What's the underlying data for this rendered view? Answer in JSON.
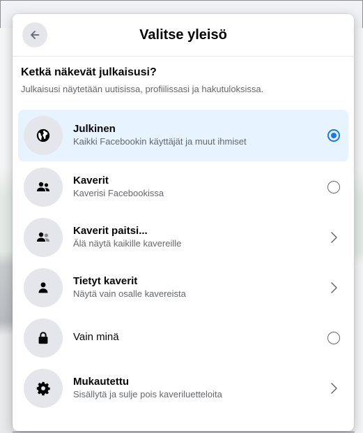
{
  "modal": {
    "title": "Valitse yleisö",
    "question": "Ketkä näkevät julkaisusi?",
    "subtitle": "Julkaisusi näytetään uutisissa, profiilissasi ja hakutuloksissa."
  },
  "options": [
    {
      "label": "Julkinen",
      "description": "Kaikki Facebookin käyttäjät ja muut ihmiset",
      "icon": "globe-icon",
      "control": "radio",
      "selected": true
    },
    {
      "label": "Kaverit",
      "description": "Kaverisi Facebookissa",
      "icon": "friends-icon",
      "control": "radio",
      "selected": false
    },
    {
      "label": "Kaverit paitsi...",
      "description": "Älä näytä kaikille kavereille",
      "icon": "friends-except-icon",
      "control": "chevron",
      "selected": false
    },
    {
      "label": "Tietyt kaverit",
      "description": "Näytä vain osalle kavereista",
      "icon": "person-icon",
      "control": "chevron",
      "selected": false
    },
    {
      "label": "Vain minä",
      "description": "",
      "icon": "lock-icon",
      "control": "radio",
      "selected": false
    },
    {
      "label": "Mukautettu",
      "description": "Sisällytä ja sulje pois kaveriluetteloita",
      "icon": "gear-icon",
      "control": "chevron",
      "selected": false
    }
  ],
  "colors": {
    "accent": "#1877f2",
    "selected_bg": "#e7f3ff"
  }
}
